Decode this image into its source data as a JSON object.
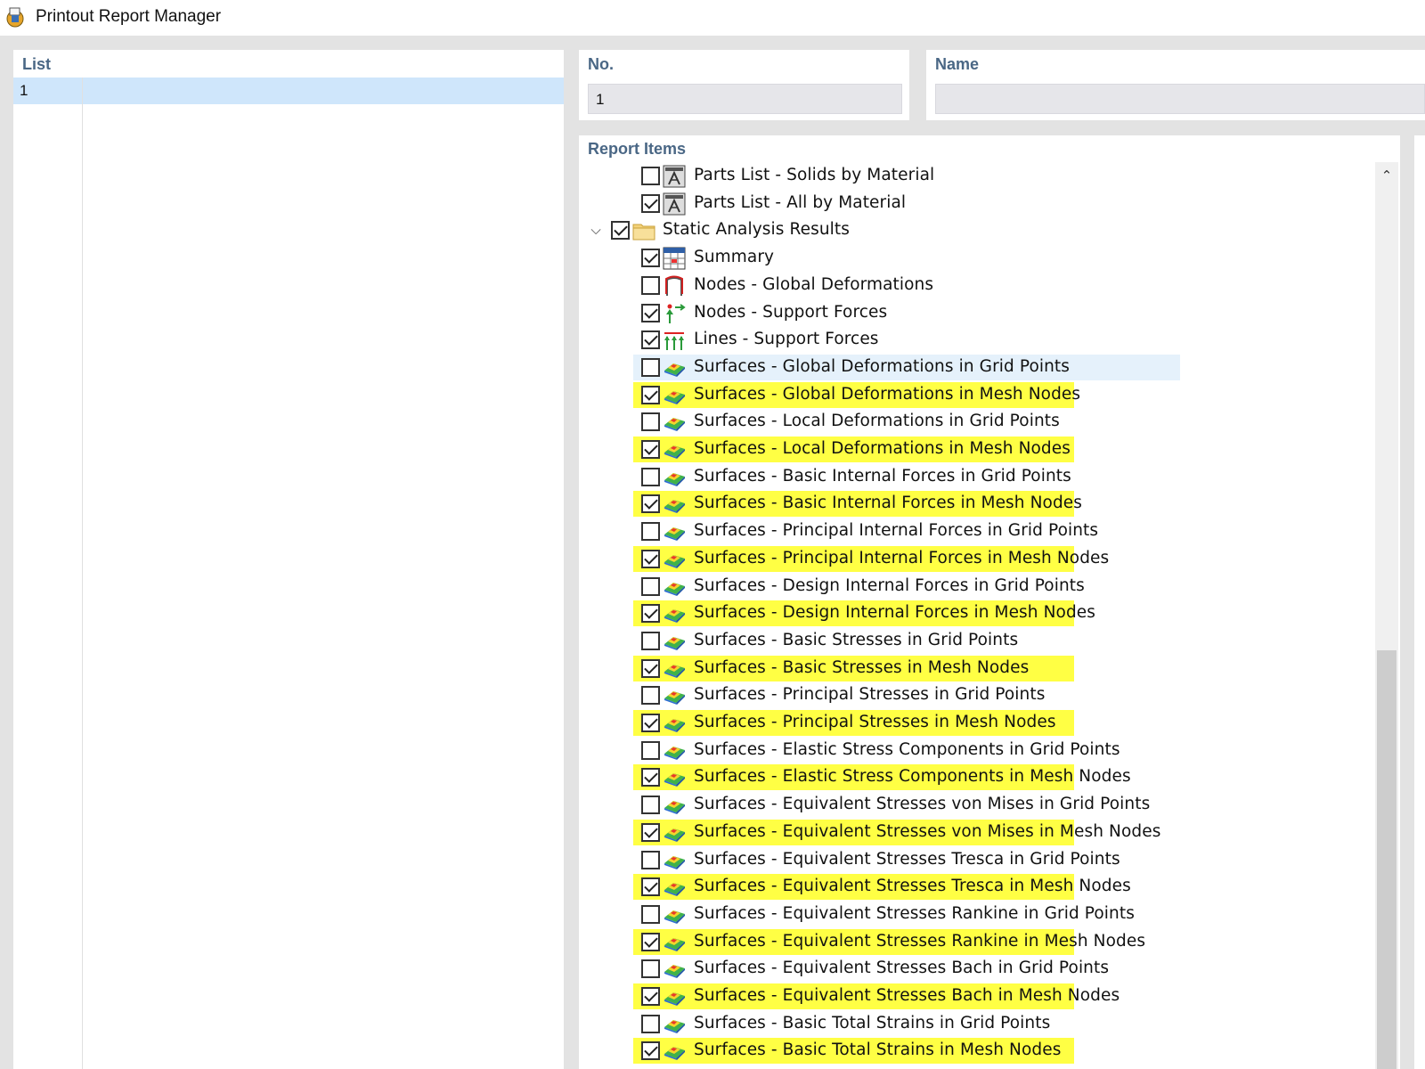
{
  "window": {
    "title": "Printout Report Manager"
  },
  "list_panel": {
    "header": "List",
    "rows": [
      {
        "number": "1",
        "description": ""
      }
    ]
  },
  "number_panel": {
    "header": "No.",
    "value": "1"
  },
  "name_panel": {
    "header": "Name",
    "value": ""
  },
  "report_items": {
    "header": "Report Items",
    "items": [
      {
        "label": "Parts List - Solids by Material",
        "checked": false,
        "level": 1,
        "icon": "parts-list-icon",
        "highlight": "none"
      },
      {
        "label": "Parts List - All by Material",
        "checked": true,
        "level": 1,
        "icon": "parts-list-icon",
        "highlight": "none"
      },
      {
        "label": "Static Analysis Results",
        "checked": true,
        "level": 0,
        "icon": "folder-icon",
        "highlight": "none",
        "expanded": true
      },
      {
        "label": "Summary",
        "checked": true,
        "level": 1,
        "icon": "summary-table-icon",
        "highlight": "none"
      },
      {
        "label": "Nodes - Global Deformations",
        "checked": false,
        "level": 1,
        "icon": "deformation-icon",
        "highlight": "none"
      },
      {
        "label": "Nodes - Support Forces",
        "checked": true,
        "level": 1,
        "icon": "node-support-icon",
        "highlight": "none"
      },
      {
        "label": "Lines - Support Forces",
        "checked": true,
        "level": 1,
        "icon": "line-support-icon",
        "highlight": "none"
      },
      {
        "label": "Surfaces - Global Deformations in Grid Points",
        "checked": false,
        "level": 1,
        "icon": "surface-result-icon",
        "highlight": "selected"
      },
      {
        "label": "Surfaces - Global Deformations in Mesh Nodes",
        "checked": true,
        "level": 1,
        "icon": "surface-result-icon",
        "highlight": "yellow"
      },
      {
        "label": "Surfaces - Local Deformations in Grid Points",
        "checked": false,
        "level": 1,
        "icon": "surface-result-icon",
        "highlight": "none"
      },
      {
        "label": "Surfaces - Local Deformations in Mesh Nodes",
        "checked": true,
        "level": 1,
        "icon": "surface-result-icon",
        "highlight": "yellow"
      },
      {
        "label": "Surfaces - Basic Internal Forces in Grid Points",
        "checked": false,
        "level": 1,
        "icon": "surface-result-icon",
        "highlight": "none"
      },
      {
        "label": "Surfaces - Basic Internal Forces in Mesh Nodes",
        "checked": true,
        "level": 1,
        "icon": "surface-result-icon",
        "highlight": "yellow"
      },
      {
        "label": "Surfaces - Principal Internal Forces in Grid Points",
        "checked": false,
        "level": 1,
        "icon": "surface-result-icon",
        "highlight": "none"
      },
      {
        "label": "Surfaces - Principal Internal Forces in Mesh Nodes",
        "checked": true,
        "level": 1,
        "icon": "surface-result-icon",
        "highlight": "yellow"
      },
      {
        "label": "Surfaces - Design Internal Forces in Grid Points",
        "checked": false,
        "level": 1,
        "icon": "surface-result-icon",
        "highlight": "none"
      },
      {
        "label": "Surfaces - Design Internal Forces in Mesh Nodes",
        "checked": true,
        "level": 1,
        "icon": "surface-result-icon",
        "highlight": "yellow"
      },
      {
        "label": "Surfaces - Basic Stresses in Grid Points",
        "checked": false,
        "level": 1,
        "icon": "surface-result-icon",
        "highlight": "none"
      },
      {
        "label": "Surfaces - Basic Stresses in Mesh Nodes",
        "checked": true,
        "level": 1,
        "icon": "surface-result-icon",
        "highlight": "yellow"
      },
      {
        "label": "Surfaces - Principal Stresses in Grid Points",
        "checked": false,
        "level": 1,
        "icon": "surface-result-icon",
        "highlight": "none"
      },
      {
        "label": "Surfaces - Principal Stresses in Mesh Nodes",
        "checked": true,
        "level": 1,
        "icon": "surface-result-icon",
        "highlight": "yellow"
      },
      {
        "label": "Surfaces - Elastic Stress Components in Grid Points",
        "checked": false,
        "level": 1,
        "icon": "surface-result-icon",
        "highlight": "none"
      },
      {
        "label": "Surfaces - Elastic Stress Components in Mesh Nodes",
        "checked": true,
        "level": 1,
        "icon": "surface-result-icon",
        "highlight": "yellow"
      },
      {
        "label": "Surfaces - Equivalent Stresses von Mises in Grid Points",
        "checked": false,
        "level": 1,
        "icon": "surface-result-icon",
        "highlight": "none"
      },
      {
        "label": "Surfaces - Equivalent Stresses von Mises in Mesh Nodes",
        "checked": true,
        "level": 1,
        "icon": "surface-result-icon",
        "highlight": "yellow"
      },
      {
        "label": "Surfaces - Equivalent Stresses Tresca in Grid Points",
        "checked": false,
        "level": 1,
        "icon": "surface-result-icon",
        "highlight": "none"
      },
      {
        "label": "Surfaces - Equivalent Stresses Tresca in Mesh Nodes",
        "checked": true,
        "level": 1,
        "icon": "surface-result-icon",
        "highlight": "yellow"
      },
      {
        "label": "Surfaces - Equivalent Stresses Rankine in Grid Points",
        "checked": false,
        "level": 1,
        "icon": "surface-result-icon",
        "highlight": "none"
      },
      {
        "label": "Surfaces - Equivalent Stresses Rankine in Mesh Nodes",
        "checked": true,
        "level": 1,
        "icon": "surface-result-icon",
        "highlight": "yellow"
      },
      {
        "label": "Surfaces - Equivalent Stresses Bach in Grid Points",
        "checked": false,
        "level": 1,
        "icon": "surface-result-icon",
        "highlight": "none"
      },
      {
        "label": "Surfaces - Equivalent Stresses Bach in Mesh Nodes",
        "checked": true,
        "level": 1,
        "icon": "surface-result-icon",
        "highlight": "yellow"
      },
      {
        "label": "Surfaces - Basic Total Strains in Grid Points",
        "checked": false,
        "level": 1,
        "icon": "surface-result-icon",
        "highlight": "none"
      },
      {
        "label": "Surfaces - Basic Total Strains in Mesh Nodes",
        "checked": true,
        "level": 1,
        "icon": "surface-result-icon",
        "highlight": "yellow"
      }
    ]
  },
  "colors": {
    "highlight": "#ffff44",
    "selection": "#e5f1fb",
    "header_text": "#4a6785",
    "list_selection": "#cfe6fb"
  }
}
